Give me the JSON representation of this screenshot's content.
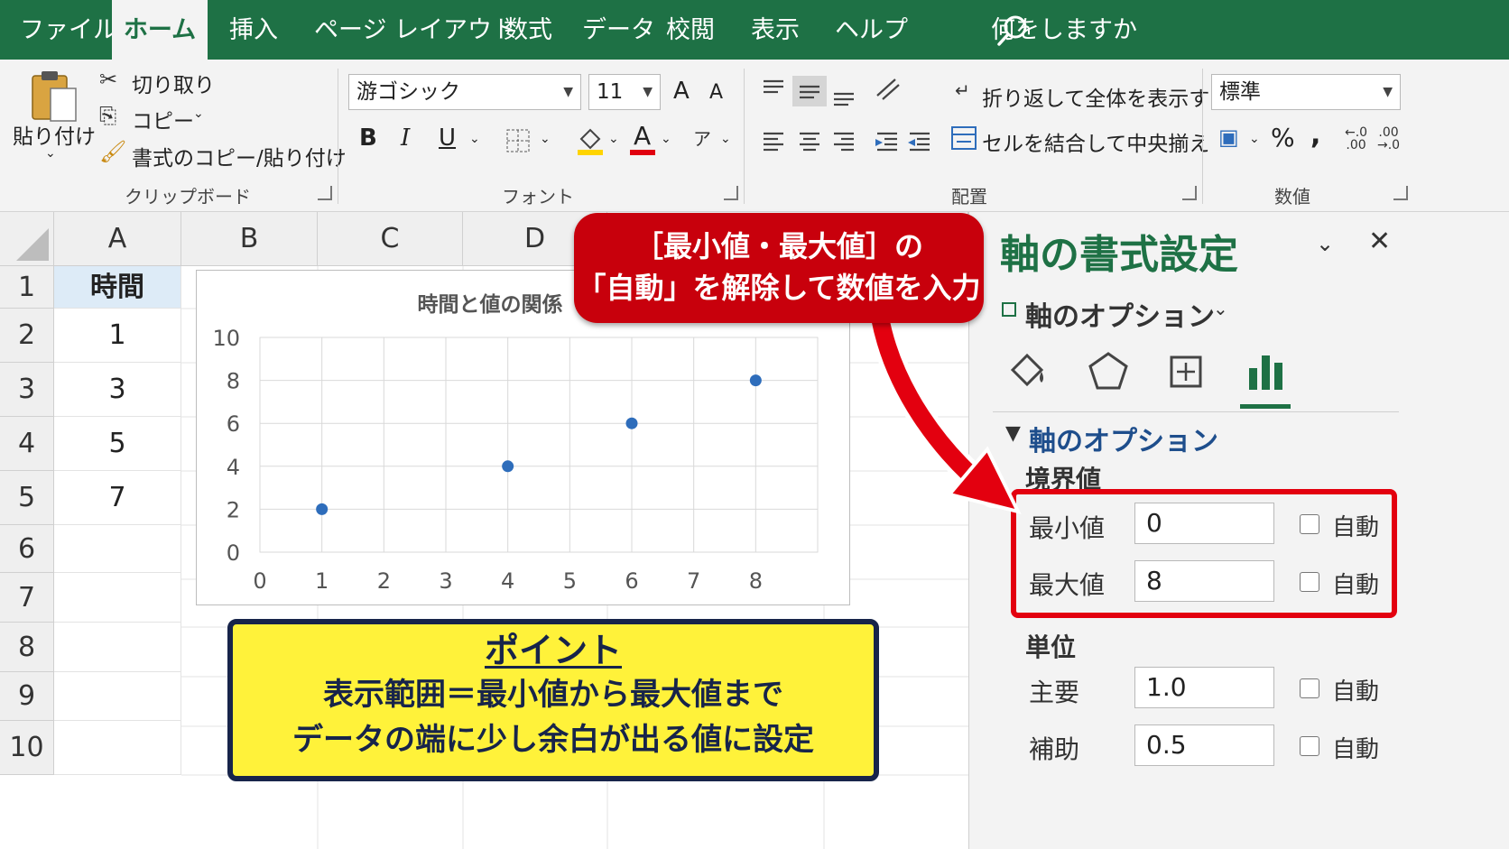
{
  "tabs": [
    {
      "label": "ファイル",
      "active": false
    },
    {
      "label": "ホーム",
      "active": true
    },
    {
      "label": "挿入",
      "active": false
    },
    {
      "label": "ページ レイアウト",
      "active": false
    },
    {
      "label": "数式",
      "active": false
    },
    {
      "label": "データ",
      "active": false
    },
    {
      "label": "校閲",
      "active": false
    },
    {
      "label": "表示",
      "active": false
    },
    {
      "label": "ヘルプ",
      "active": false
    }
  ],
  "tell_me": "何をしますか",
  "clipboard": {
    "paste": "貼り付け",
    "cut": "切り取り",
    "copy": "コピー",
    "format_painter": "書式のコピー/貼り付け",
    "group": "クリップボード"
  },
  "font": {
    "name": "游ゴシック",
    "size": "11",
    "bold": "B",
    "italic": "I",
    "underline": "U",
    "grow": "A",
    "shrink": "A",
    "color_glyph": "A",
    "group": "フォント"
  },
  "alignment": {
    "wrap": "折り返して全体を表示する",
    "merge": "セルを結合して中央揃え",
    "group": "配置"
  },
  "number": {
    "format": "標準",
    "percent": "%",
    "comma": ",",
    "group": "数値"
  },
  "columns": [
    "A",
    "B",
    "C",
    "D"
  ],
  "rows": [
    "1",
    "2",
    "3",
    "4",
    "5",
    "6",
    "7",
    "8",
    "9",
    "10"
  ],
  "cells_a": [
    "時間",
    "1",
    "3",
    "5",
    "7",
    "",
    "",
    "",
    "",
    ""
  ],
  "chart_data": {
    "type": "scatter",
    "title": "時間と値の関係",
    "series": [
      {
        "x": [
          1,
          4,
          6,
          8
        ],
        "y": [
          2,
          4,
          6,
          8
        ]
      }
    ],
    "xlim": [
      0,
      9
    ],
    "ylim": [
      0,
      10
    ],
    "x_ticks": [
      "0",
      "1",
      "2",
      "3",
      "4",
      "5",
      "6",
      "7",
      "8"
    ],
    "y_ticks": [
      "0",
      "2",
      "4",
      "6",
      "8",
      "10"
    ],
    "grid": true,
    "marker_color": "#2e6dbb"
  },
  "callout_red": {
    "line1": "［最小値・最大値］の",
    "line2": "「自動」を解除して数値を入力"
  },
  "callout_yellow": {
    "heading": "ポイント",
    "line1": "表示範囲＝最小値から最大値まで",
    "line2": "データの端に少し余白が出る値に設定"
  },
  "pane": {
    "title": "軸の書式設定",
    "options_dropdown": "軸のオプション",
    "section": "軸のオプション",
    "bounds_label": "境界値",
    "min_label": "最小値",
    "min_value": "0",
    "max_label": "最大値",
    "max_value": "8",
    "units_label": "単位",
    "major_label": "主要",
    "major_value": "1.0",
    "minor_label": "補助",
    "minor_value": "0.5",
    "auto": "自動"
  },
  "colors": {
    "excel_green": "#1e7145",
    "highlight_red": "#e3000f",
    "callout_yellow": "#fff23a",
    "callout_navy": "#17244a"
  }
}
